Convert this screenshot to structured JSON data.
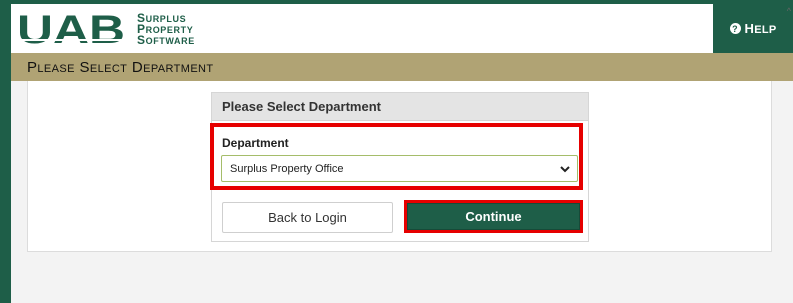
{
  "app": {
    "logo_text": "UAB",
    "brand_lines": [
      "Surplus",
      "Property",
      "Software"
    ],
    "help_label": "Help",
    "help_icon": "question-circle-icon"
  },
  "page": {
    "title": "Please Select Department"
  },
  "panel": {
    "heading": "Please Select Department",
    "department_label": "Department",
    "department_selected": "Surplus Property Office",
    "back_label": "Back to Login",
    "continue_label": "Continue"
  },
  "colors": {
    "brand_green": "#1e5e48",
    "title_bar": "#b0a374",
    "highlight_red": "#e60000"
  }
}
